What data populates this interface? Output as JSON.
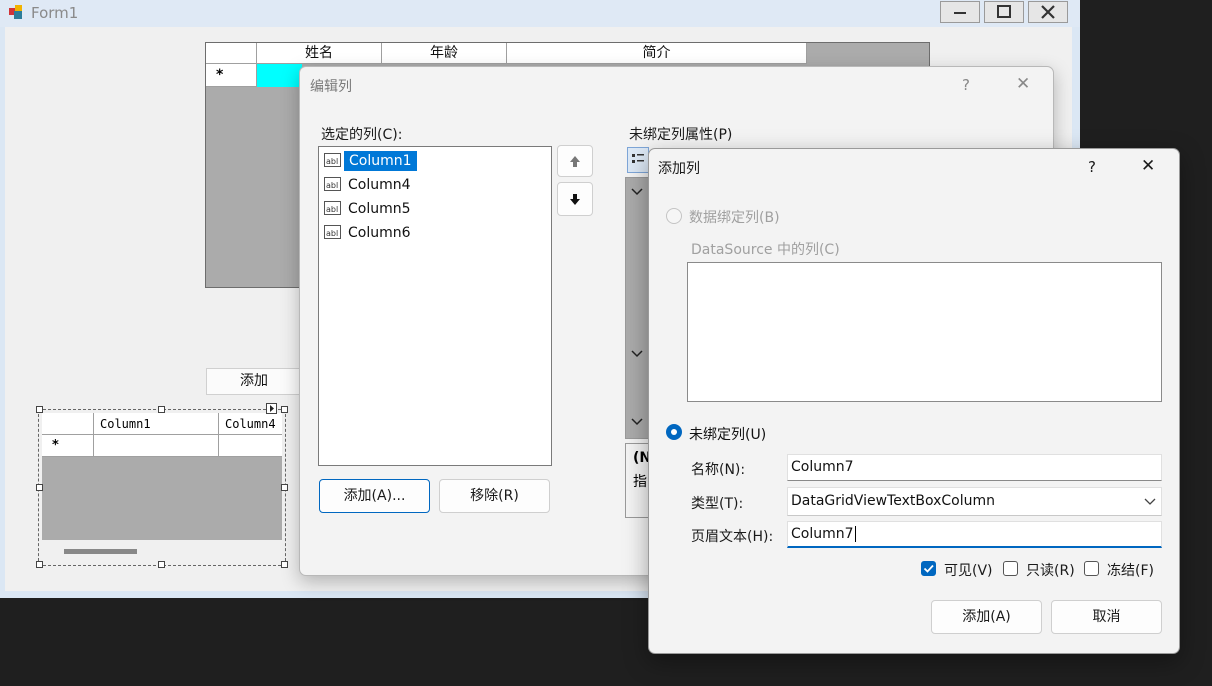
{
  "form": {
    "title": "Form1",
    "grid1": {
      "headers": [
        "姓名",
        "年龄",
        "简介"
      ],
      "new_row_marker": "*"
    },
    "add_button": "添加",
    "grid2": {
      "headers": [
        "Column1",
        "Column4"
      ],
      "new_row_marker": "*"
    }
  },
  "edit_dialog": {
    "title": "编辑列",
    "help": "?",
    "close": "✕",
    "selected_label": "选定的列(C):",
    "columns": [
      "Column1",
      "Column4",
      "Column5",
      "Column6"
    ],
    "selected_index": 0,
    "properties_label": "未绑定列属性(P)",
    "add_button": "添加(A)...",
    "remove_button": "移除(R)",
    "prop_fragment_1": "(N",
    "prop_fragment_2": "指"
  },
  "add_dialog": {
    "title": "添加列",
    "help": "?",
    "close": "✕",
    "bound_radio": "数据绑定列(B)",
    "datasource_label": "DataSource 中的列(C)",
    "unbound_radio": "未绑定列(U)",
    "name_label": "名称(N):",
    "name_value": "Column7",
    "type_label": "类型(T):",
    "type_value": "DataGridViewTextBoxColumn",
    "header_label": "页眉文本(H):",
    "header_value": "Column7",
    "visible_label": "可见(V)",
    "visible_checked": true,
    "readonly_label": "只读(R)",
    "frozen_label": "冻结(F)",
    "add_button": "添加(A)",
    "cancel_button": "取消"
  },
  "colors": {
    "accent": "#0067c0",
    "selection": "#0078d7",
    "cyan_cell": "#00ffff"
  }
}
